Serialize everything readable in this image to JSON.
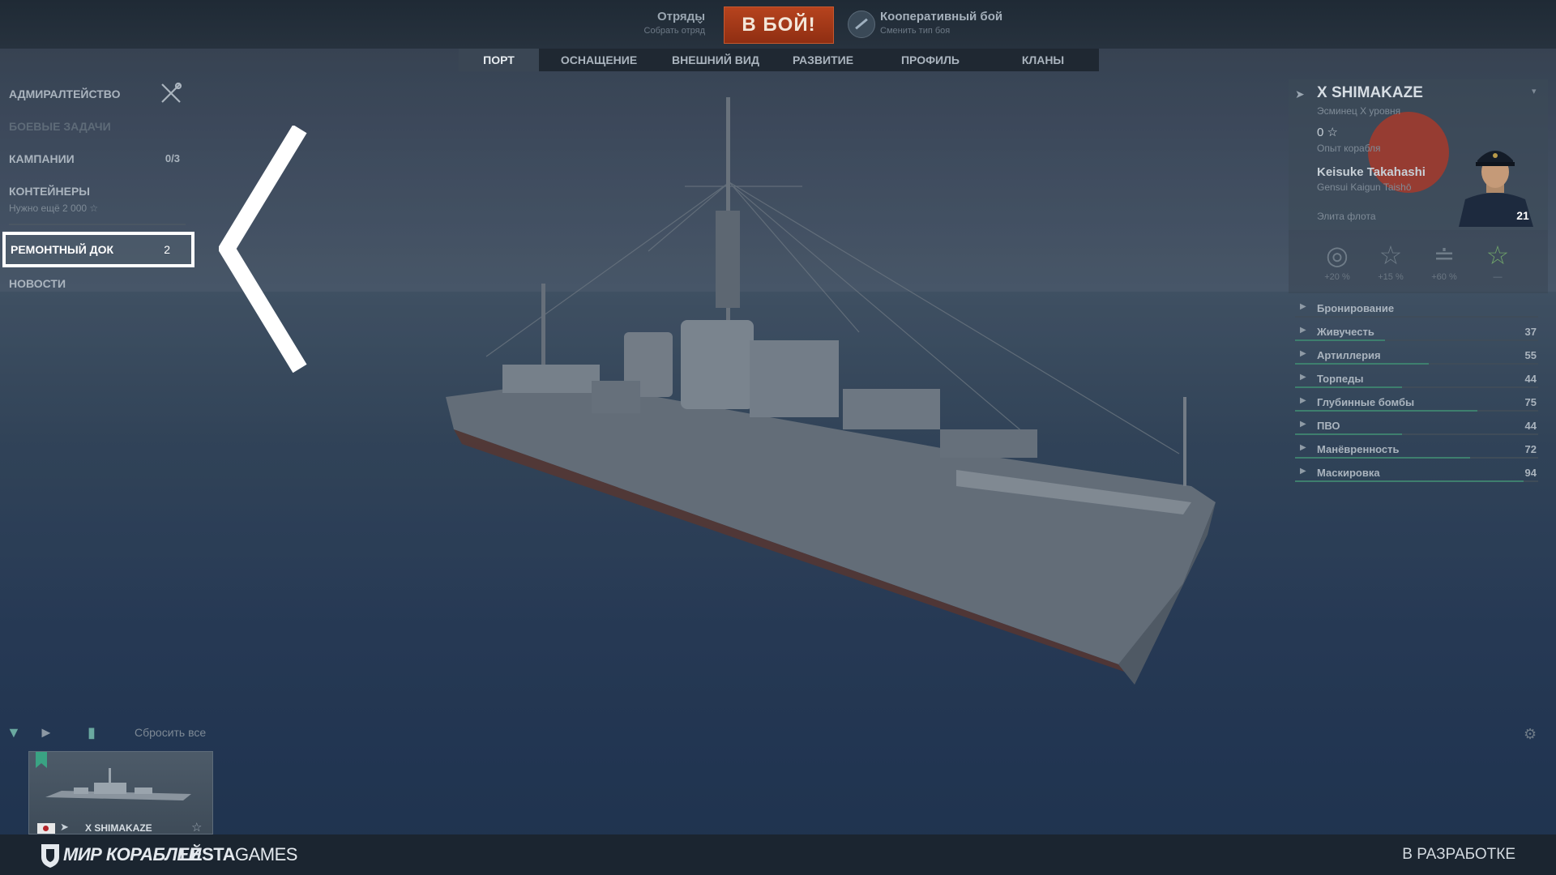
{
  "topbar": {
    "squads_title": "Отряды",
    "squads_sub": "Собрать отряд",
    "battle_button": "В БОЙ!",
    "mode_title": "Кооперативный бой",
    "mode_sub": "Сменить тип боя"
  },
  "tabs": [
    "ПОРТ",
    "ОСНАЩЕНИЕ",
    "ВНЕШНИЙ ВИД",
    "РАЗВИТИЕ",
    "ПРОФИЛЬ",
    "КЛАНЫ"
  ],
  "left_menu": {
    "admiralty": "АДМИРАЛТЕЙСТВО",
    "combat_missions": "БОЕВЫЕ ЗАДАЧИ",
    "campaigns": "КАМПАНИИ",
    "campaigns_count": "0/3",
    "containers": "КОНТЕЙНЕРЫ",
    "containers_sub": "Нужно ещё  2 000 ☆",
    "repair_dock": "РЕМОНТНЫЙ ДОК",
    "repair_dock_count": "2",
    "news": "НОВОСТИ"
  },
  "ship_panel": {
    "name": "X SHIMAKAZE",
    "subtitle": "Эсминец X уровня",
    "xp": "0 ☆",
    "xp_label": "Опыт корабля",
    "commander": "Keisuke Takahashi",
    "commander_rank": "Gensui Kaigun Taishō",
    "elite_label": "Элита флота",
    "commander_points": "21",
    "bonuses": [
      "+20 %",
      "+15 %",
      "+60 %",
      "—"
    ],
    "stats": [
      {
        "name": "Бронирование",
        "value": "",
        "fill": 0
      },
      {
        "name": "Живучесть",
        "value": "37",
        "fill": 0.37
      },
      {
        "name": "Артиллерия",
        "value": "55",
        "fill": 0.55
      },
      {
        "name": "Торпеды",
        "value": "44",
        "fill": 0.44
      },
      {
        "name": "Глубинные бомбы",
        "value": "75",
        "fill": 0.75
      },
      {
        "name": "ПВО",
        "value": "44",
        "fill": 0.44
      },
      {
        "name": "Манёвренность",
        "value": "72",
        "fill": 0.72
      },
      {
        "name": "Маскировка",
        "value": "94",
        "fill": 0.94
      }
    ]
  },
  "carousel": {
    "reset_all": "Сбросить все",
    "card_name": "X SHIMAKAZE"
  },
  "bottom": {
    "logo_game": "МИР КОРАБЛЕЙ",
    "logo_publisher_a": "LESTA",
    "logo_publisher_b": "GAMES",
    "status": "В РАЗРАБОТКЕ"
  },
  "colors": {
    "battle_button": "#a33a17",
    "accent_green": "#3aa383",
    "highlight_border": "#ffffff"
  }
}
